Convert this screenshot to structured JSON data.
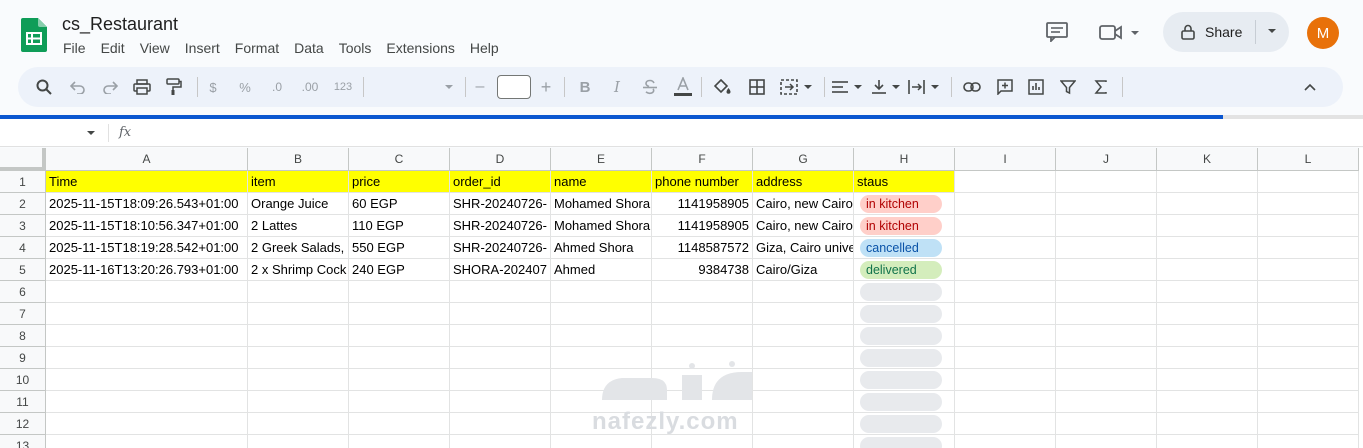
{
  "app": {
    "doc_title": "cs_Restaurant",
    "menu": [
      "File",
      "Edit",
      "View",
      "Insert",
      "Format",
      "Data",
      "Tools",
      "Extensions",
      "Help"
    ],
    "share_label": "Share",
    "avatar_initial": "M"
  },
  "toolbar": {
    "currency": "$",
    "percent": "%",
    "dec_decrease": ".0",
    "dec_increase": ".00",
    "number_format": "123",
    "font_minus": "–",
    "font_plus": "+",
    "bold": "B",
    "italic": "I"
  },
  "formula_bar": {
    "fx": "fx",
    "value": ""
  },
  "sheet": {
    "columns": [
      "A",
      "B",
      "C",
      "D",
      "E",
      "F",
      "G",
      "H",
      "I",
      "J",
      "K",
      "L"
    ],
    "row_numbers": [
      "1",
      "2",
      "3",
      "4",
      "5",
      "6",
      "7",
      "8",
      "9",
      "10",
      "11",
      "12",
      "13"
    ],
    "header_row": [
      "Time",
      "item",
      "price",
      "order_id",
      "name",
      "phone number",
      "address",
      "staus"
    ],
    "rows": [
      [
        "2025-11-15T18:09:26.543+01:00",
        "Orange Juice",
        "60 EGP",
        "SHR-20240726-",
        "Mohamed Shora",
        "1141958905",
        "Cairo, new Cairo",
        "in kitchen"
      ],
      [
        "2025-11-15T18:10:56.347+01:00",
        "2 Lattes",
        "110 EGP",
        "SHR-20240726-",
        "Mohamed Shora",
        "1141958905",
        "Cairo, new Cairo",
        "in kitchen"
      ],
      [
        "2025-11-15T18:19:28.542+01:00",
        "2 Greek Salads,",
        "550 EGP",
        "SHR-20240726-",
        "Ahmed Shora",
        "1148587572",
        "Giza, Cairo unive",
        "cancelled"
      ],
      [
        "2025-11-16T13:20:26.793+01:00",
        "2 x Shrimp Cock",
        "240 EGP",
        "SHORA-202407",
        "Ahmed",
        "9384738",
        "Cairo/Giza",
        "delivered"
      ]
    ],
    "status_colors": {
      "in kitchen": {
        "bg": "#ffcfc9",
        "fg": "#b10202"
      },
      "cancelled": {
        "bg": "#bfe1f6",
        "fg": "#0a53a8"
      },
      "delivered": {
        "bg": "#d4edbc",
        "fg": "#11734b"
      }
    },
    "header_fill": "#ffff00"
  },
  "watermark": {
    "text": "nafezly.com"
  },
  "colors": {
    "accent": "#0b57d0",
    "avatar_bg": "#e8710a",
    "sheets_green": "#0f9d58"
  }
}
